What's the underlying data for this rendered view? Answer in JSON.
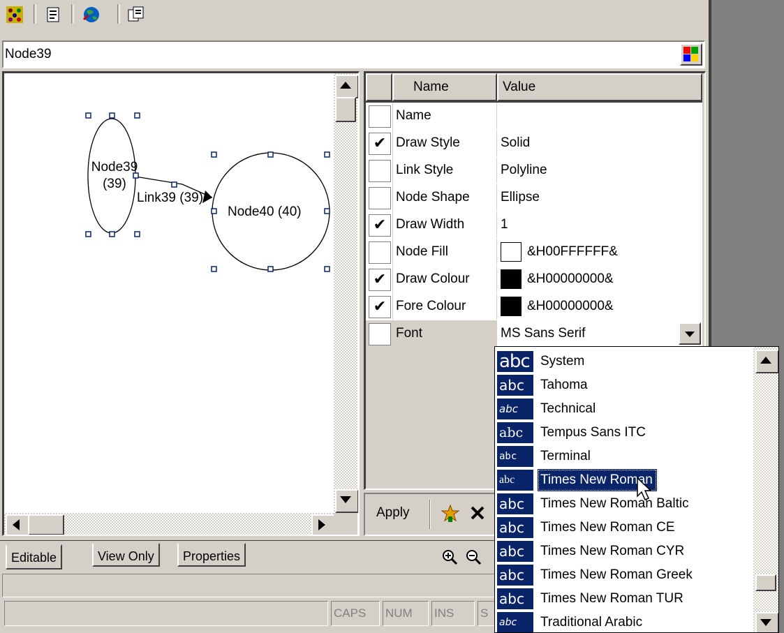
{
  "toolbar": {
    "icons": [
      "layout-icon",
      "properties-icon",
      "globe-icon",
      "copy-icon"
    ]
  },
  "node_field": {
    "value": "Node39",
    "color_icon": "palette-icon"
  },
  "diagram": {
    "node39_label_line1": "Node39",
    "node39_label_line2": "(39)",
    "node40_label": "Node40 (40)",
    "link_label": "Link39 (39)"
  },
  "grid": {
    "headers": {
      "name": "Name",
      "value": "Value"
    },
    "rows": [
      {
        "name": "Name",
        "value": "",
        "checked": false
      },
      {
        "name": "Draw Style",
        "value": "Solid",
        "checked": true
      },
      {
        "name": "Link Style",
        "value": "Polyline",
        "checked": false
      },
      {
        "name": "Node Shape",
        "value": "Ellipse",
        "checked": false
      },
      {
        "name": "Draw Width",
        "value": "1",
        "checked": true
      },
      {
        "name": "Node Fill",
        "value": "&H00FFFFFF&",
        "checked": false,
        "swatch": "#ffffff"
      },
      {
        "name": "Draw Colour",
        "value": "&H00000000&",
        "checked": true,
        "swatch": "#000000"
      },
      {
        "name": "Fore Colour",
        "value": "&H00000000&",
        "checked": true,
        "swatch": "#000000"
      },
      {
        "name": "Font",
        "value": "MS Sans Serif",
        "checked": false
      }
    ]
  },
  "font_list": {
    "items": [
      {
        "icon": "abc",
        "name": "System"
      },
      {
        "icon": "abc",
        "name": "Tahoma"
      },
      {
        "icon": "abc",
        "name": "Technical"
      },
      {
        "icon": "abc",
        "name": "Tempus Sans ITC"
      },
      {
        "icon": "abc",
        "name": "Terminal"
      },
      {
        "icon": "abc",
        "name": "Times New Roman",
        "selected": true
      },
      {
        "icon": "abc",
        "name": "Times New Roman Baltic"
      },
      {
        "icon": "abc",
        "name": "Times New Roman CE"
      },
      {
        "icon": "abc",
        "name": "Times New Roman CYR"
      },
      {
        "icon": "abc",
        "name": "Times New Roman Greek"
      },
      {
        "icon": "abc",
        "name": "Times New Roman TUR"
      },
      {
        "icon": "abc",
        "name": "Traditional Arabic"
      }
    ]
  },
  "bottom_bar": {
    "apply_label": "Apply"
  },
  "tabs": [
    "Editable",
    "View Only",
    "Properties"
  ],
  "status": {
    "caps": "CAPS",
    "num": "NUM",
    "ins": "INS",
    "scrl": "S"
  }
}
